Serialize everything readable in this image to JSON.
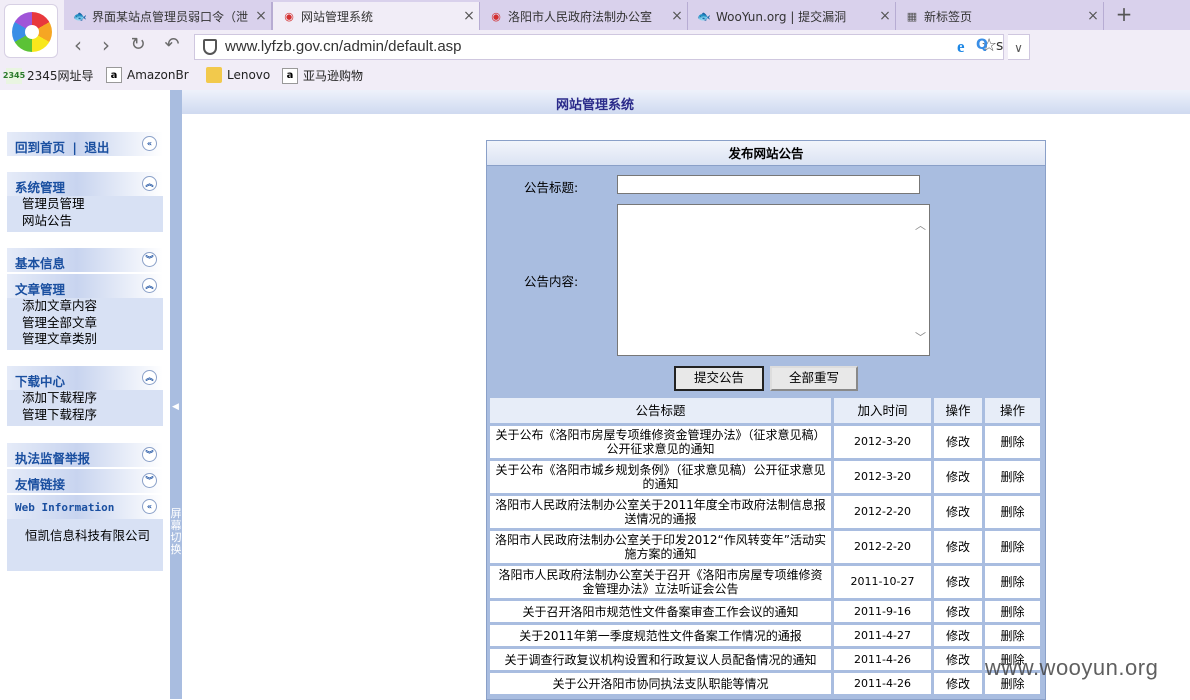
{
  "browser": {
    "tabs": [
      {
        "icon": "wooyun-icon",
        "title": "界面某站点管理员弱口令（泄",
        "active": false
      },
      {
        "icon": "emblem-icon",
        "title": "网站管理系统",
        "active": true
      },
      {
        "icon": "emblem-icon",
        "title": "洛阳市人民政府法制办公室",
        "active": false
      },
      {
        "icon": "wooyun-icon",
        "title": "WooYun.org | 提交漏洞",
        "active": false
      },
      {
        "icon": "grid-icon",
        "title": "新标签页",
        "active": false
      }
    ],
    "url": "www.lyfzb.gov.cn/admin/default.asp",
    "search_query": "s",
    "bookmarks": [
      {
        "icon": "2345-icon",
        "label": "2345网址导"
      },
      {
        "icon": "amazon-icon",
        "label": "AmazonBr"
      },
      {
        "icon": "folder-icon",
        "label": "Lenovo"
      },
      {
        "icon": "amazon-icon",
        "label": "亚马逊购物"
      }
    ]
  },
  "page": {
    "header_title": "网站管理系统",
    "splitter_label": "屏幕切换"
  },
  "sidebar": {
    "top_links": {
      "home": "回到首页",
      "sep": "|",
      "logout": "退出"
    },
    "groups": [
      {
        "title": "系统管理",
        "expanded": true,
        "items": [
          "管理员管理",
          "网站公告"
        ]
      },
      {
        "title": "基本信息",
        "expanded": false,
        "items": []
      },
      {
        "title": "文章管理",
        "expanded": true,
        "items": [
          "添加文章内容",
          "管理全部文章",
          "管理文章类别"
        ]
      },
      {
        "title": "下载中心",
        "expanded": true,
        "items": [
          "添加下载程序",
          "管理下载程序"
        ]
      },
      {
        "title": "执法监督举报",
        "expanded": false,
        "items": []
      },
      {
        "title": "友情链接",
        "expanded": false,
        "items": []
      },
      {
        "title": "Web Information",
        "expanded": true,
        "items": [
          "恒凯信息科技有限公司"
        ]
      }
    ]
  },
  "form": {
    "heading": "发布网站公告",
    "title_label": "公告标题:",
    "title_value": "",
    "content_label": "公告内容:",
    "content_value": "",
    "submit_label": "提交公告",
    "reset_label": "全部重写"
  },
  "table": {
    "headers": {
      "title": "公告标题",
      "date": "加入时间",
      "op1": "操作",
      "op2": "操作"
    },
    "rows": [
      {
        "title": "关于公布《洛阳市房屋专项维修资金管理办法》（征求意见稿）公开征求意见的通知",
        "date": "2012-3-20",
        "edit": "修改",
        "del": "删除"
      },
      {
        "title": "关于公布《洛阳市城乡规划条例》（征求意见稿）公开征求意见的通知",
        "date": "2012-3-20",
        "edit": "修改",
        "del": "删除"
      },
      {
        "title": "洛阳市人民政府法制办公室关于2011年度全市政府法制信息报送情况的通报",
        "date": "2012-2-20",
        "edit": "修改",
        "del": "删除"
      },
      {
        "title": "洛阳市人民政府法制办公室关于印发2012“作风转变年”活动实施方案的通知",
        "date": "2012-2-20",
        "edit": "修改",
        "del": "删除"
      },
      {
        "title": "洛阳市人民政府法制办公室关于召开《洛阳市房屋专项维修资金管理办法》立法听证会公告",
        "date": "2011-10-27",
        "edit": "修改",
        "del": "删除"
      },
      {
        "title": "关于召开洛阳市规范性文件备案审查工作会议的通知",
        "date": "2011-9-16",
        "edit": "修改",
        "del": "删除"
      },
      {
        "title": "关于2011年第一季度规范性文件备案工作情况的通报",
        "date": "2011-4-27",
        "edit": "修改",
        "del": "删除"
      },
      {
        "title": "关于调查行政复议机构设置和行政复议人员配备情况的通知",
        "date": "2011-4-26",
        "edit": "修改",
        "del": "删除"
      },
      {
        "title": "关于公开洛阳市协同执法支队职能等情况",
        "date": "2011-4-26",
        "edit": "修改",
        "del": "删除"
      }
    ]
  },
  "watermark": "www.wooyun.org"
}
